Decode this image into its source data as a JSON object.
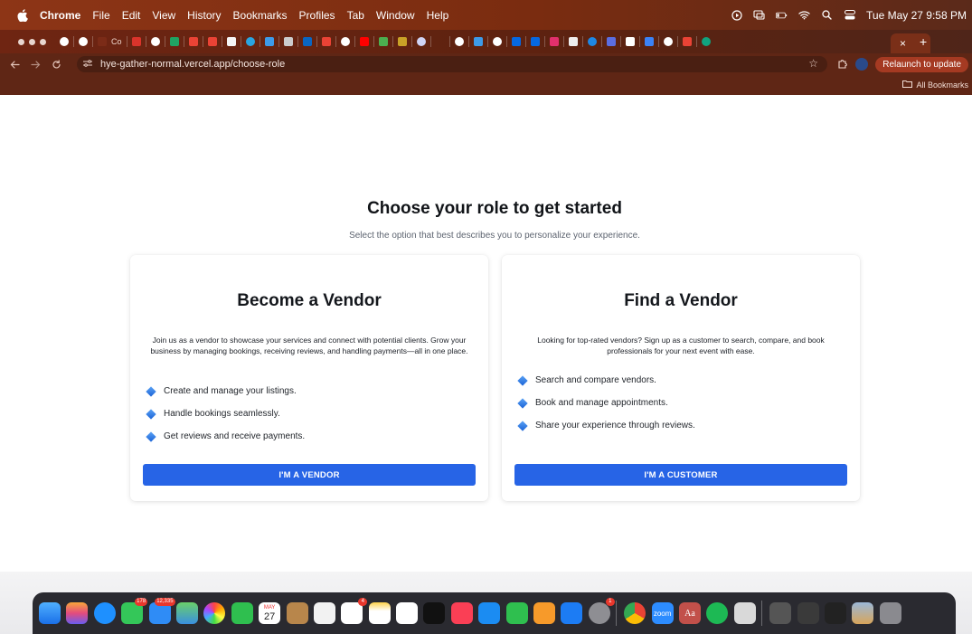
{
  "menubar": {
    "app": "Chrome",
    "items": [
      "File",
      "Edit",
      "View",
      "History",
      "Bookmarks",
      "Profiles",
      "Tab",
      "Window",
      "Help"
    ],
    "datetime": "Tue May 27  9:58 PM"
  },
  "tabs": {
    "partial_tab_text": "Co",
    "active_close": "×",
    "new_tab": "+"
  },
  "toolbar": {
    "url": "hye-gather-normal.vercel.app/choose-role",
    "relaunch_label": "Relaunch to update"
  },
  "bookmarks": {
    "all_label": "All Bookmarks"
  },
  "page": {
    "title": "Choose your role to get started",
    "subtitle": "Select the option that best describes you to personalize your experience."
  },
  "vendor_card": {
    "heading": "Become a Vendor",
    "description": "Join us as a vendor to showcase your services and connect with potential clients. Grow your business by managing bookings, receiving reviews, and handling payments—all in one place.",
    "features": [
      "Create and manage your listings.",
      "Handle bookings seamlessly.",
      "Get reviews and receive payments."
    ],
    "button": "I'M A VENDOR"
  },
  "customer_card": {
    "heading": "Find a Vendor",
    "description": "Looking for top-rated vendors? Sign up as a customer to search, compare, and book professionals for your next event with ease.",
    "features": [
      "Search and compare vendors.",
      "Book and manage appointments.",
      "Share your experience through reviews."
    ],
    "button": "I'M A CUSTOMER"
  },
  "dock": {
    "badges": {
      "messages": "178",
      "mail": "12,335",
      "reminders": "4",
      "settings": "1"
    },
    "calendar_month": "MAY",
    "calendar_day": "27",
    "zoom_label": "zoom",
    "dictionary_label": "Aa"
  },
  "colors": {
    "accent": "#2764e6",
    "menubar": "#8d3516",
    "toolbar": "#5f2615"
  }
}
